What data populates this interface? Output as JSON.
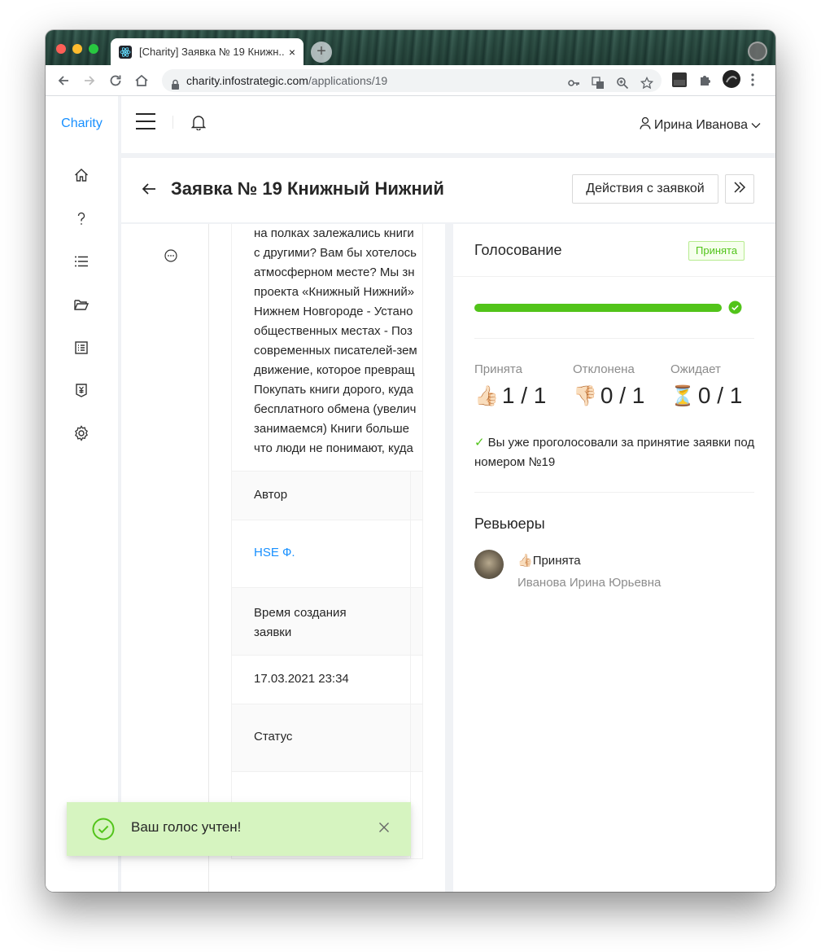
{
  "browser": {
    "tab_title": "[Charity] Заявка № 19 Книжн...",
    "tab_close": "×",
    "new_tab": "+",
    "url_host": "charity.infostrategic.com",
    "url_path": "/applications/19"
  },
  "app": {
    "brand": "Charity",
    "user_name": "Ирина Иванова",
    "page_title": "Заявка № 19 Книжный Нижний",
    "actions_button": "Действия с заявкой"
  },
  "description": {
    "lines": [
      "на полках залежались книги",
      "с другими? Вам бы хотелось",
      "атмосферном месте? Мы зн",
      "проекта «Книжный Нижний»",
      "Нижнем Новгороде - Устано",
      "общественных местах - Поз",
      "современных писателей-зем",
      "движение, которое превращ",
      "Покупать книги дорого, куда",
      "бесплатного обмена (увелич",
      "занимаемся) Книги больше",
      "что люди не понимают, куда"
    ]
  },
  "details": {
    "author_label": "Автор",
    "author_value": "HSE Ф.",
    "created_label": "Время создания заявки",
    "created_value": "17.03.2021 23:34",
    "status_label": "Статус"
  },
  "voting": {
    "title": "Голосование",
    "status_tag": "Принята",
    "progress_fraction": 1.0,
    "accepted_label": "Принята",
    "accepted_value": "1 / 1",
    "rejected_label": "Отклонена",
    "rejected_value": "0 / 1",
    "pending_label": "Ожидает",
    "pending_value": "0 / 1",
    "voted_message": "Вы уже проголосовали за принятие заявки под номером №19",
    "reviewers_title": "Ревьюеры",
    "reviewer_decision": "Принята",
    "reviewer_name": "Иванова Ирина Юрьевна"
  },
  "toast": {
    "message": "Ваш голос учтен!"
  },
  "colors": {
    "accent": "#1890ff",
    "success": "#52c41a",
    "toast_bg": "#d6f4c0"
  }
}
